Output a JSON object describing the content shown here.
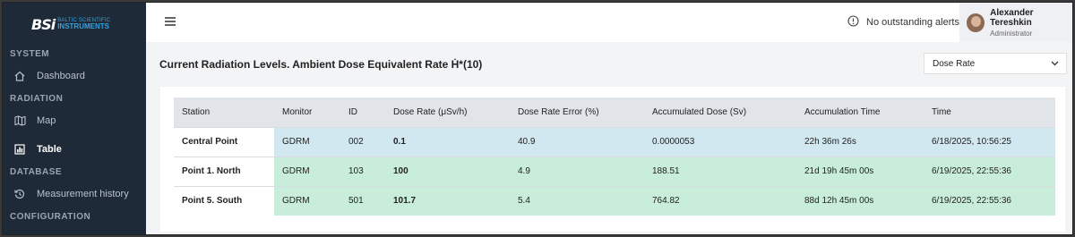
{
  "logo": {
    "brand": "BSi",
    "line1": "BALTIC SCIENTIFIC",
    "line2": "INSTRUMENTS"
  },
  "sidebar": {
    "sections": [
      {
        "label": "SYSTEM"
      },
      {
        "label": "RADIATION"
      },
      {
        "label": "DATABASE"
      },
      {
        "label": "CONFIGURATION"
      }
    ],
    "items": [
      {
        "label": "Dashboard",
        "icon": "home-icon"
      },
      {
        "label": "Map",
        "icon": "map-icon"
      },
      {
        "label": "Table",
        "icon": "bar-chart-icon"
      },
      {
        "label": "Measurement history",
        "icon": "history-icon"
      }
    ]
  },
  "topbar": {
    "alerts_text": "No outstanding alerts",
    "user_name": "Alexander Tereshkin",
    "user_role": "Administrator"
  },
  "page": {
    "title": "Current Radiation Levels. Ambient Dose Equivalent Rate Ḣ*(10)",
    "select_value": "Dose Rate"
  },
  "table": {
    "headers": [
      "Station",
      "Monitor",
      "ID",
      "Dose Rate  (μSv/h)",
      "Dose Rate Error  (%)",
      "Accumulated Dose  (Sv)",
      "Accumulation Time",
      "Time"
    ],
    "rows": [
      {
        "station": "Central Point",
        "monitor": "GDRM",
        "id": "002",
        "rate": "0.1",
        "error": "40.9",
        "accum": "0.0000053",
        "time_acc": "22h 36m 26s",
        "time": "6/18/2025, 10:56:25",
        "color": "#d2e8f1"
      },
      {
        "station": "Point 1. North",
        "monitor": "GDRM",
        "id": "103",
        "rate": "100",
        "error": "4.9",
        "accum": "188.51",
        "time_acc": "21d 19h 45m 00s",
        "time": "6/19/2025, 22:55:36",
        "color": "#c8eddb"
      },
      {
        "station": "Point 5. South",
        "monitor": "GDRM",
        "id": "501",
        "rate": "101.7",
        "error": "5.4",
        "accum": "764.82",
        "time_acc": "88d 12h 45m 00s",
        "time": "6/19/2025, 22:55:36",
        "color": "#c8eddb"
      }
    ]
  }
}
